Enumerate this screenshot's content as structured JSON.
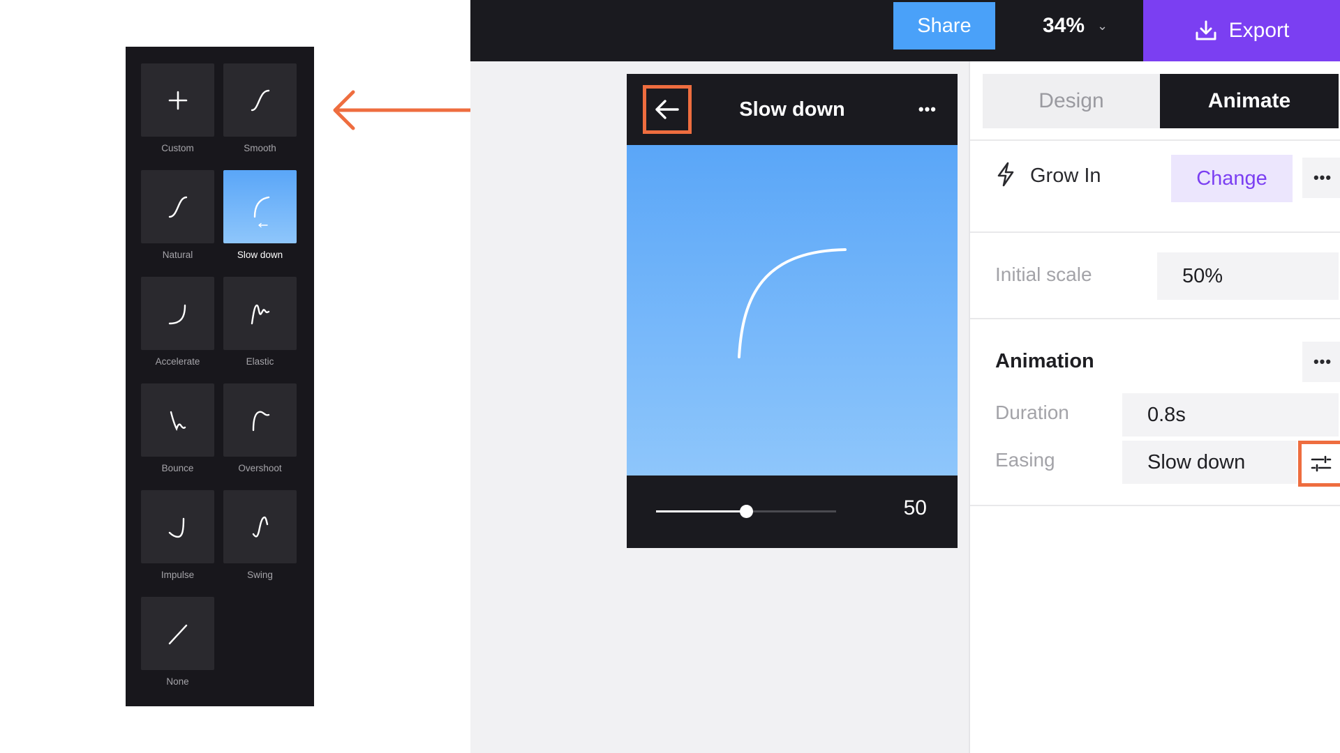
{
  "picker": {
    "presets": [
      {
        "label": "Custom",
        "icon": "plus-icon",
        "selected": false
      },
      {
        "label": "Smooth",
        "icon": "ease-smooth-icon",
        "selected": false
      },
      {
        "label": "Natural",
        "icon": "ease-natural-icon",
        "selected": false
      },
      {
        "label": "Slow down",
        "icon": "ease-slow-down-icon",
        "selected": true
      },
      {
        "label": "Accelerate",
        "icon": "ease-accelerate-icon",
        "selected": false
      },
      {
        "label": "Elastic",
        "icon": "ease-elastic-icon",
        "selected": false
      },
      {
        "label": "Bounce",
        "icon": "ease-bounce-icon",
        "selected": false
      },
      {
        "label": "Overshoot",
        "icon": "ease-overshoot-icon",
        "selected": false
      },
      {
        "label": "Impulse",
        "icon": "ease-impulse-icon",
        "selected": false
      },
      {
        "label": "Swing",
        "icon": "ease-swing-icon",
        "selected": false
      },
      {
        "label": "None",
        "icon": "ease-none-icon",
        "selected": false
      }
    ]
  },
  "topbar": {
    "share_label": "Share",
    "zoom_value": "34%",
    "export_label": "Export"
  },
  "editor": {
    "title": "Slow down",
    "slider_value": "50",
    "slider_fraction": 0.5
  },
  "panel": {
    "tabs": {
      "design": "Design",
      "animate": "Animate",
      "active": "Animate"
    },
    "effect_name": "Grow In",
    "change_label": "Change",
    "initial_scale_label": "Initial scale",
    "initial_scale_value": "50%",
    "animation_title": "Animation",
    "duration_label": "Duration",
    "duration_value": "0.8s",
    "easing_label": "Easing",
    "easing_value": "Slow down"
  },
  "colors": {
    "accent_purple": "#7b3ff2",
    "share_blue": "#4aa1f9",
    "highlight_orange": "#ee6d3f",
    "dark": "#1a1a1f"
  }
}
